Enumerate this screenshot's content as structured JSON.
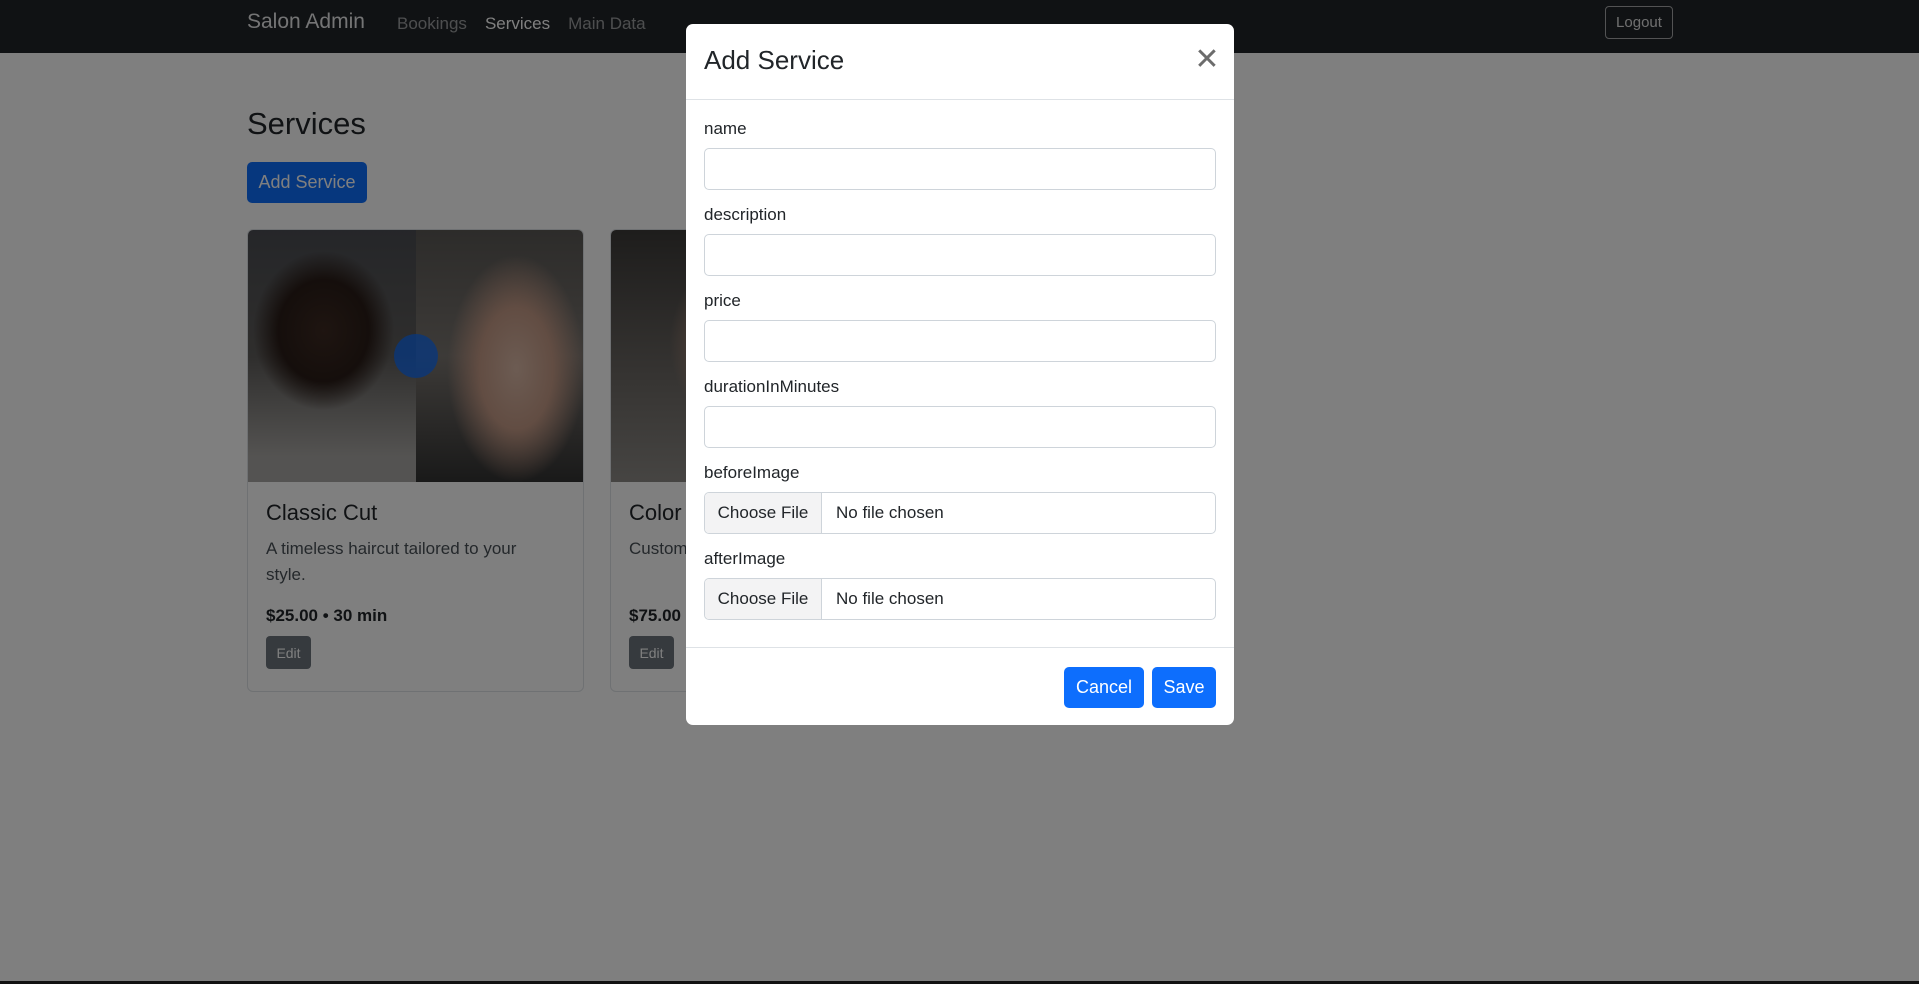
{
  "navbar": {
    "brand": "Salon Admin",
    "links": [
      {
        "label": "Bookings",
        "active": false
      },
      {
        "label": "Services",
        "active": true
      },
      {
        "label": "Main Data",
        "active": false
      }
    ],
    "logout_label": "Logout"
  },
  "main": {
    "title": "Services",
    "add_button_label": "Add Service",
    "cards": [
      {
        "title": "Classic Cut",
        "description": "A timeless haircut tailored to your style.",
        "meta": "$25.00 • 30 min",
        "edit_label": "Edit"
      },
      {
        "title": "Color",
        "description": "Custom... fresh lo...",
        "meta": "$75.00",
        "edit_label": "Edit"
      }
    ]
  },
  "modal": {
    "title": "Add Service",
    "fields": {
      "name": {
        "label": "name",
        "value": ""
      },
      "description": {
        "label": "description",
        "value": ""
      },
      "price": {
        "label": "price",
        "value": ""
      },
      "duration": {
        "label": "durationInMinutes",
        "value": ""
      },
      "before_image": {
        "label": "beforeImage",
        "button": "Choose File",
        "status": "No file chosen"
      },
      "after_image": {
        "label": "afterImage",
        "button": "Choose File",
        "status": "No file chosen"
      }
    },
    "cancel_label": "Cancel",
    "save_label": "Save"
  },
  "colors": {
    "primary": "#0d6efd",
    "navbar": "#212529",
    "secondary": "#6c757d"
  }
}
